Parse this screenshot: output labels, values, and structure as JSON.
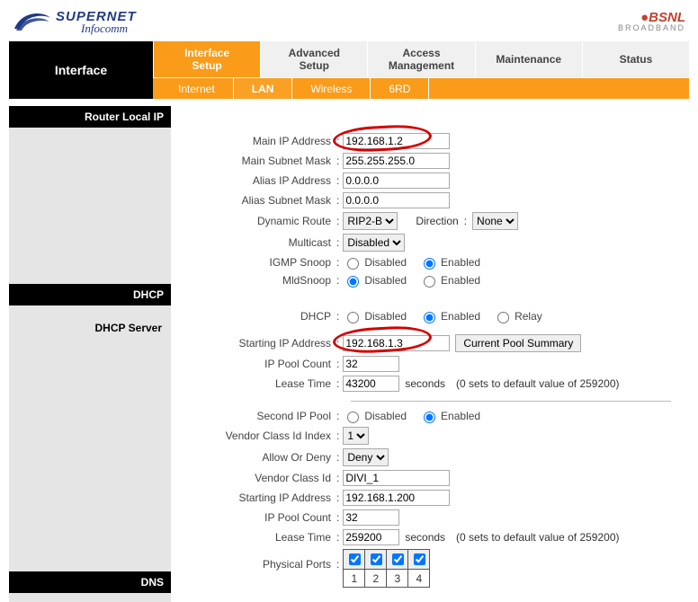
{
  "brand": {
    "left_line1": "SUPERNET",
    "left_line2": "Infocomm",
    "right_line1": "BSNL",
    "right_line2": "BROADBAND"
  },
  "nav": {
    "title": "Interface",
    "main": [
      {
        "label": "Interface\nSetup",
        "active": true
      },
      {
        "label": "Advanced\nSetup",
        "active": false
      },
      {
        "label": "Access\nManagement",
        "active": false
      },
      {
        "label": "Maintenance",
        "active": false
      },
      {
        "label": "Status",
        "active": false
      }
    ],
    "sub": [
      {
        "label": "Internet",
        "active": false
      },
      {
        "label": "LAN",
        "active": true
      },
      {
        "label": "Wireless",
        "active": false
      },
      {
        "label": "6RD",
        "active": false
      }
    ]
  },
  "sections": {
    "router_local_ip": "Router Local IP",
    "dhcp": "DHCP",
    "dhcp_server": "DHCP Server",
    "dns": "DNS"
  },
  "labels": {
    "main_ip": "Main IP Address",
    "main_subnet": "Main Subnet Mask",
    "alias_ip": "Alias IP Address",
    "alias_subnet": "Alias Subnet Mask",
    "dynamic_route": "Dynamic Route",
    "direction": "Direction",
    "multicast": "Multicast",
    "igmp_snoop": "IGMP Snoop",
    "mld_snoop": "MldSnoop",
    "dhcp": "DHCP",
    "starting_ip": "Starting IP Address",
    "ip_pool_count": "IP Pool Count",
    "lease_time": "Lease Time",
    "lease_unit": "seconds",
    "lease_note": "(0 sets to default value of 259200)",
    "second_ip_pool": "Second IP Pool",
    "vendor_idx": "Vendor Class Id Index",
    "allow_deny": "Allow Or Deny",
    "vendor_id": "Vendor Class Id",
    "physical_ports": "Physical Ports",
    "current_pool": "Current Pool Summary",
    "disabled": "Disabled",
    "enabled": "Enabled",
    "relay": "Relay",
    "none": "None"
  },
  "values": {
    "main_ip": "192.168.1.2",
    "main_subnet": "255.255.255.0",
    "alias_ip": "0.0.0.0",
    "alias_subnet": "0.0.0.0",
    "dynamic_route": "RIP2-B",
    "direction": "None",
    "multicast": "Disabled",
    "igmp_snoop": "enabled",
    "mld_snoop": "disabled",
    "dhcp_mode": "enabled",
    "starting_ip": "192.168.1.3",
    "ip_pool_count": "32",
    "lease_time": "43200",
    "second_ip_pool": "enabled",
    "vendor_idx": "1",
    "allow_deny": "Deny",
    "vendor_id": "DIVI_1",
    "starting_ip2": "192.168.1.200",
    "ip_pool_count2": "32",
    "lease_time2": "259200",
    "ports": [
      "1",
      "2",
      "3",
      "4"
    ]
  }
}
